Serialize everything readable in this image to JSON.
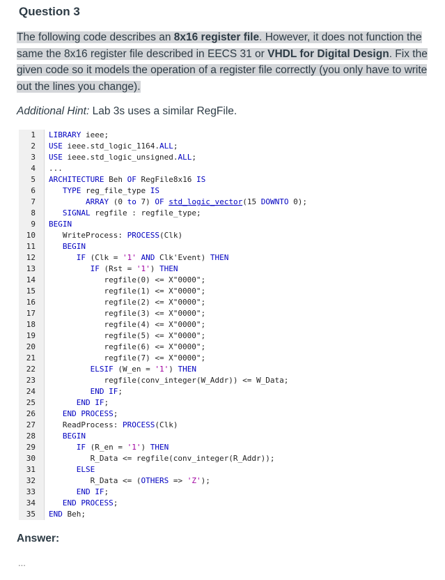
{
  "question": {
    "title": "Question 3"
  },
  "intro": {
    "seg1": "The following code describes an ",
    "seg2": "8x16 register file",
    "seg3": ". However, it does not function the same the 8x16 register file described in EECS 31 or ",
    "seg4": "VHDL for Digital Design",
    "seg5": ". Fix the given code so it models the operation of a register file correctly (you only have to write out the lines you change)."
  },
  "hint": {
    "label": "Additional Hint:",
    "text": " Lab 3s uses a similar RegFile."
  },
  "code_lines": [
    [
      [
        "kw",
        "LIBRARY"
      ],
      [
        "t",
        " ieee;"
      ]
    ],
    [
      [
        "kw",
        "USE"
      ],
      [
        "t",
        " ieee.std_logic_1164."
      ],
      [
        "kw",
        "ALL"
      ],
      [
        "t",
        ";"
      ]
    ],
    [
      [
        "kw",
        "USE"
      ],
      [
        "t",
        " ieee.std_logic_unsigned."
      ],
      [
        "kw",
        "ALL"
      ],
      [
        "t",
        ";"
      ]
    ],
    [
      [
        "t",
        "..."
      ]
    ],
    [
      [
        "kw",
        "ARCHITECTURE"
      ],
      [
        "t",
        " Beh "
      ],
      [
        "kw",
        "OF"
      ],
      [
        "t",
        " RegFile8x16 "
      ],
      [
        "kw",
        "IS"
      ]
    ],
    [
      [
        "t",
        "   "
      ],
      [
        "kw",
        "TYPE"
      ],
      [
        "t",
        " reg_file_type "
      ],
      [
        "kw",
        "IS"
      ]
    ],
    [
      [
        "t",
        "        "
      ],
      [
        "kw",
        "ARRAY"
      ],
      [
        "t",
        " (0 "
      ],
      [
        "kw",
        "to"
      ],
      [
        "t",
        " 7) "
      ],
      [
        "kw",
        "OF"
      ],
      [
        "t",
        " "
      ],
      [
        "ty",
        "std_logic_vector"
      ],
      [
        "t",
        "(15 "
      ],
      [
        "kw",
        "DOWNTO"
      ],
      [
        "t",
        " 0);"
      ]
    ],
    [
      [
        "t",
        "   "
      ],
      [
        "kw",
        "SIGNAL"
      ],
      [
        "t",
        " regfile : regfile_type;"
      ]
    ],
    [
      [
        "kw",
        "BEGIN"
      ]
    ],
    [
      [
        "t",
        "   WriteProcess: "
      ],
      [
        "kw",
        "PROCESS"
      ],
      [
        "t",
        "(Clk)"
      ]
    ],
    [
      [
        "t",
        "   "
      ],
      [
        "kw",
        "BEGIN"
      ]
    ],
    [
      [
        "t",
        "      "
      ],
      [
        "kw",
        "IF"
      ],
      [
        "t",
        " (Clk = "
      ],
      [
        "st",
        "'1'"
      ],
      [
        "t",
        " "
      ],
      [
        "kw",
        "AND"
      ],
      [
        "t",
        " Clk'Event) "
      ],
      [
        "kw",
        "THEN"
      ]
    ],
    [
      [
        "t",
        "         "
      ],
      [
        "kw",
        "IF"
      ],
      [
        "t",
        " (Rst = "
      ],
      [
        "st",
        "'1'"
      ],
      [
        "t",
        ") "
      ],
      [
        "kw",
        "THEN"
      ]
    ],
    [
      [
        "t",
        "            regfile(0) <= X\"0000\";"
      ]
    ],
    [
      [
        "t",
        "            regfile(1) <= X\"0000\";"
      ]
    ],
    [
      [
        "t",
        "            regfile(2) <= X\"0000\";"
      ]
    ],
    [
      [
        "t",
        "            regfile(3) <= X\"0000\";"
      ]
    ],
    [
      [
        "t",
        "            regfile(4) <= X\"0000\";"
      ]
    ],
    [
      [
        "t",
        "            regfile(5) <= X\"0000\";"
      ]
    ],
    [
      [
        "t",
        "            regfile(6) <= X\"0000\";"
      ]
    ],
    [
      [
        "t",
        "            regfile(7) <= X\"0000\";"
      ]
    ],
    [
      [
        "t",
        "         "
      ],
      [
        "kw",
        "ELSIF"
      ],
      [
        "t",
        " (W_en = "
      ],
      [
        "st",
        "'1'"
      ],
      [
        "t",
        ") "
      ],
      [
        "kw",
        "THEN"
      ]
    ],
    [
      [
        "t",
        "            regfile(conv_integer(W_Addr)) <= W_Data;"
      ]
    ],
    [
      [
        "t",
        "         "
      ],
      [
        "kw",
        "END IF"
      ],
      [
        "t",
        ";"
      ]
    ],
    [
      [
        "t",
        "      "
      ],
      [
        "kw",
        "END IF"
      ],
      [
        "t",
        ";"
      ]
    ],
    [
      [
        "t",
        "   "
      ],
      [
        "kw",
        "END PROCESS"
      ],
      [
        "t",
        ";"
      ]
    ],
    [
      [
        "t",
        "   ReadProcess: "
      ],
      [
        "kw",
        "PROCESS"
      ],
      [
        "t",
        "(Clk)"
      ]
    ],
    [
      [
        "t",
        "   "
      ],
      [
        "kw",
        "BEGIN"
      ]
    ],
    [
      [
        "t",
        "      "
      ],
      [
        "kw",
        "IF"
      ],
      [
        "t",
        " (R_en = "
      ],
      [
        "st",
        "'1'"
      ],
      [
        "t",
        ") "
      ],
      [
        "kw",
        "THEN"
      ]
    ],
    [
      [
        "t",
        "         R_Data <= regfile(conv_integer(R_Addr));"
      ]
    ],
    [
      [
        "t",
        "      "
      ],
      [
        "kw",
        "ELSE"
      ]
    ],
    [
      [
        "t",
        "         R_Data <= ("
      ],
      [
        "kw",
        "OTHERS"
      ],
      [
        "t",
        " => "
      ],
      [
        "st",
        "'Z'"
      ],
      [
        "t",
        ");"
      ]
    ],
    [
      [
        "t",
        "      "
      ],
      [
        "kw",
        "END IF"
      ],
      [
        "t",
        ";"
      ]
    ],
    [
      [
        "t",
        "   "
      ],
      [
        "kw",
        "END PROCESS"
      ],
      [
        "t",
        ";"
      ]
    ],
    [
      [
        "kw",
        "END"
      ],
      [
        "t",
        " Beh;"
      ]
    ]
  ],
  "answer": {
    "label": "Answer:",
    "placeholder": "..."
  }
}
